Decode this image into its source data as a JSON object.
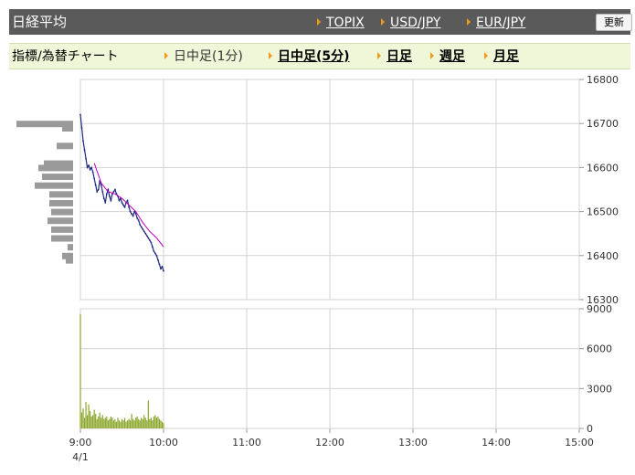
{
  "header": {
    "title": "日経平均",
    "links": [
      "TOPIX",
      "USD/JPY",
      "EUR/JPY"
    ],
    "refresh_label": "更新"
  },
  "subnav": {
    "label": "指標/為替チャート",
    "tabs": [
      {
        "label": "日中足(1分)",
        "active": true
      },
      {
        "label": "日中足(5分)",
        "active": false
      },
      {
        "label": "日足",
        "active": false
      },
      {
        "label": "週足",
        "active": false
      },
      {
        "label": "月足",
        "active": false
      }
    ]
  },
  "colors": {
    "accent_triangle": "#f39a1b",
    "price_line": "#1f2a80",
    "moving_average": "#c000c0",
    "volume_bar": "#8aa62a",
    "volume_profile": "#9a9a9a",
    "grid": "#d3d3d3"
  },
  "chart_data": {
    "type": "line",
    "x_ticks": [
      "9:00",
      "10:00",
      "11:00",
      "12:00",
      "13:00",
      "14:00",
      "15:00"
    ],
    "date_label": "4/1",
    "price": {
      "ylim": [
        16300,
        16800
      ],
      "y_ticks": [
        "16800",
        "16700",
        "16600",
        "16500",
        "16400",
        "16300"
      ],
      "series": [
        {
          "x": [
            0,
            1,
            2,
            3,
            4,
            5,
            6,
            7,
            8,
            9,
            10,
            11,
            12,
            13,
            14,
            15,
            16,
            17,
            18,
            19,
            20,
            21,
            22,
            23,
            24,
            25,
            26,
            27,
            28,
            29,
            30,
            31,
            32,
            33,
            34,
            35,
            36,
            37,
            38,
            39,
            40,
            41,
            42,
            43,
            44,
            45,
            46,
            47,
            48,
            49,
            50,
            51,
            52,
            53,
            54,
            55,
            56,
            57,
            58,
            59,
            60
          ],
          "y": [
            16720,
            16690,
            16660,
            16640,
            16620,
            16600,
            16605,
            16595,
            16600,
            16590,
            16575,
            16560,
            16545,
            16550,
            16570,
            16560,
            16545,
            16530,
            16520,
            16540,
            16550,
            16535,
            16525,
            16540,
            16545,
            16550,
            16540,
            16535,
            16525,
            16530,
            16520,
            16515,
            16510,
            16520,
            16525,
            16510,
            16500,
            16495,
            16490,
            16500,
            16495,
            16485,
            16480,
            16470,
            16465,
            16460,
            16455,
            16450,
            16445,
            16440,
            16435,
            16430,
            16420,
            16410,
            16405,
            16400,
            16390,
            16380,
            16370,
            16375,
            16365
          ]
        }
      ],
      "moving_average": {
        "x": [
          10,
          15,
          20,
          25,
          30,
          35,
          40,
          45,
          50,
          55,
          60
        ],
        "y": [
          16610,
          16565,
          16545,
          16540,
          16530,
          16515,
          16500,
          16475,
          16455,
          16440,
          16420
        ]
      }
    },
    "volume": {
      "ylim": [
        0,
        9000
      ],
      "y_ticks": [
        "9000",
        "6000",
        "3000",
        "0"
      ],
      "x": [
        0,
        1,
        2,
        3,
        4,
        5,
        6,
        7,
        8,
        9,
        10,
        11,
        12,
        13,
        14,
        15,
        16,
        17,
        18,
        19,
        20,
        21,
        22,
        23,
        24,
        25,
        26,
        27,
        28,
        29,
        30,
        31,
        32,
        33,
        34,
        35,
        36,
        37,
        38,
        39,
        40,
        41,
        42,
        43,
        44,
        45,
        46,
        47,
        48,
        49,
        50,
        51,
        52,
        53,
        54,
        55,
        56,
        57,
        58,
        59,
        60
      ],
      "values": [
        8600,
        1200,
        1500,
        800,
        2000,
        1000,
        1800,
        1300,
        900,
        1000,
        1400,
        1100,
        700,
        900,
        1200,
        800,
        1000,
        700,
        800,
        900,
        600,
        700,
        900,
        800,
        600,
        700,
        500,
        800,
        600,
        500,
        700,
        600,
        800,
        500,
        600,
        700,
        600,
        1100,
        700,
        600,
        800,
        900,
        700,
        600,
        800,
        700,
        1000,
        800,
        600,
        2100,
        700,
        800,
        600,
        900,
        1000,
        800,
        900,
        700,
        600,
        500,
        400
      ]
    },
    "volume_profile": {
      "price_levels": [
        16700,
        16690,
        16650,
        16610,
        16600,
        16580,
        16560,
        16540,
        16520,
        16500,
        16480,
        16460,
        16440,
        16420,
        16400,
        16390
      ],
      "widths": [
        62,
        12,
        18,
        32,
        38,
        34,
        42,
        26,
        26,
        24,
        28,
        24,
        24,
        6,
        12,
        8
      ]
    },
    "grid": true
  }
}
